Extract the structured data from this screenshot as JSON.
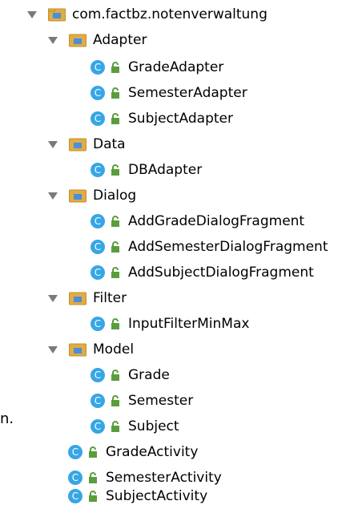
{
  "tree": {
    "root": {
      "label": "com.factbz.notenverwaltung",
      "icon": "package-folder-icon",
      "expanded": true
    },
    "folders": [
      {
        "label": "Adapter",
        "expanded": true,
        "classes": [
          "GradeAdapter",
          "SemesterAdapter",
          "SubjectAdapter"
        ]
      },
      {
        "label": "Data",
        "expanded": true,
        "classes": [
          "DBAdapter"
        ]
      },
      {
        "label": "Dialog",
        "expanded": true,
        "classes": [
          "AddGradeDialogFragment",
          "AddSemesterDialogFragment",
          "AddSubjectDialogFragment"
        ]
      },
      {
        "label": "Filter",
        "expanded": true,
        "classes": [
          "InputFilterMinMax"
        ]
      },
      {
        "label": "Model",
        "expanded": true,
        "classes": [
          "Grade",
          "Semester",
          "Subject"
        ]
      }
    ],
    "root_classes": [
      "GradeActivity",
      "SemesterActivity",
      "SubjectActivity"
    ]
  },
  "stray_text": "n.",
  "colors": {
    "arrow": "#7a7a7a",
    "folder_body": "#e0ac45",
    "folder_inner": "#4a8fd8",
    "class_circle": "#36a6e6",
    "lock": "#5a9d3c"
  }
}
